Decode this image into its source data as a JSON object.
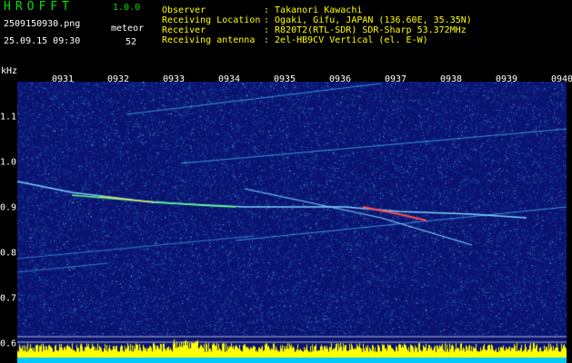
{
  "header": {
    "app_title": "HROFFT",
    "version": "1.0.0",
    "filename": "2509150930.png",
    "datetime": "25.09.15 09:30",
    "meteor_label": "meteor",
    "meteor_count": "52",
    "info": [
      {
        "label": "Observer",
        "value": ": Takanori Kawachi"
      },
      {
        "label": "Receiving Location",
        "value": ": Ogaki, Gifu, JAPAN (136.60E, 35.35N)"
      },
      {
        "label": "Receiver",
        "value": ": R820T2(RTL-SDR) SDR-Sharp 53.372MHz"
      },
      {
        "label": "Receiving antenna",
        "value": ": 2el-HB9CV Vertical (el. E-W)"
      }
    ]
  },
  "axis": {
    "unit": "kHz",
    "time_ticks": [
      "0931",
      "0932",
      "0933",
      "0934",
      "0935",
      "0936",
      "0937",
      "0938",
      "0939",
      "0940"
    ],
    "freq_ticks": [
      "1.1",
      "1.0",
      "0.9",
      "0.8",
      "0.7",
      "0.6"
    ]
  },
  "colors": {
    "background": "#0a1470",
    "noise": "#2a7fd0",
    "trace": "#7fd0ff",
    "strong_echo": "#ff5050",
    "header_green": "#00e000",
    "header_yellow": "#ffff00",
    "level_bars": "#ffff00",
    "level_base": "#00c8ff"
  }
}
